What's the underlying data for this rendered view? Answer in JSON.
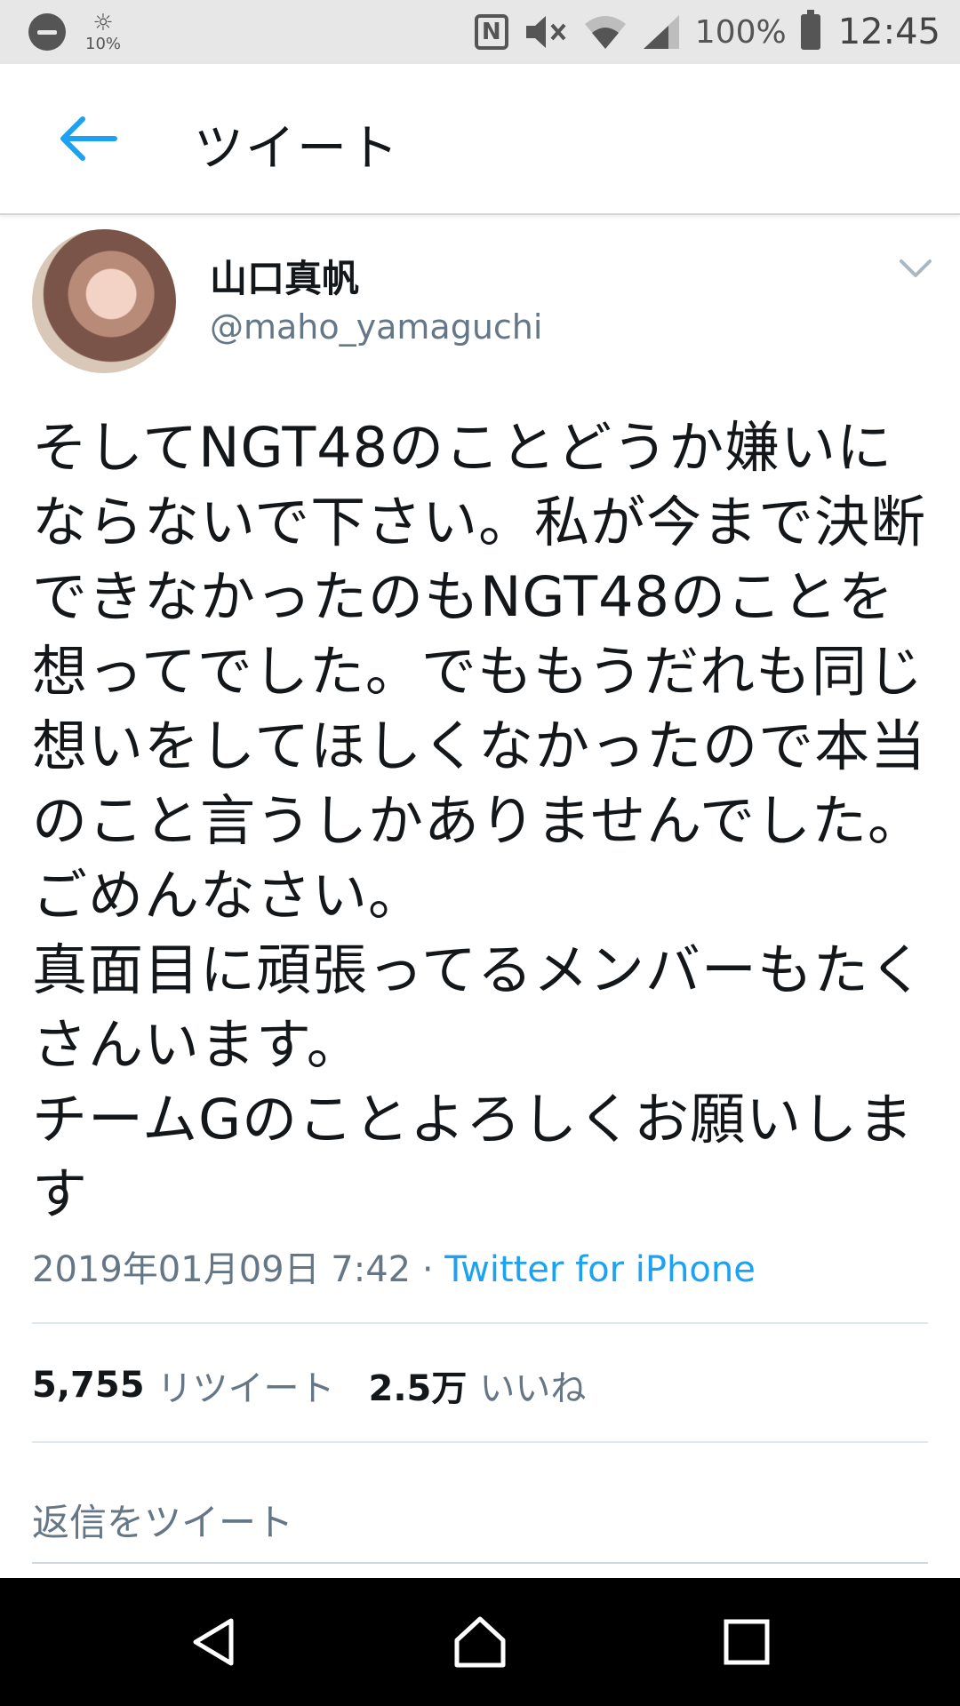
{
  "status_bar": {
    "brightness": "10%",
    "battery": "100%",
    "time": "12:45"
  },
  "header": {
    "title": "ツイート"
  },
  "tweet": {
    "author_name": "山口真帆",
    "author_handle": "@maho_yamaguchi",
    "text_paragraphs": [
      "そしてNGT48のことどうか嫌いにならないで下さい。私が今まで決断できなかったのもNGT48のことを想ってでした。でももうだれも同じ想いをしてほしくなかったので本当のこと言うしかありませんでした。ごめんなさい。",
      "真面目に頑張ってるメンバーもたくさんいます。",
      "チームGのことよろしくお願いします"
    ],
    "timestamp": "2019年01月09日 7:42",
    "separator": " · ",
    "source": "Twitter for iPhone",
    "retweet_count": "5,755",
    "retweet_label": "リツイート",
    "like_count": "2.5万",
    "like_label": "いいね"
  },
  "reply": {
    "placeholder": "返信をツイート"
  },
  "colors": {
    "accent": "#1da1f2",
    "secondary_text": "#657786",
    "primary_text": "#14171a"
  },
  "icons": [
    "do-not-disturb-icon",
    "brightness-icon",
    "nfc-icon",
    "mute-icon",
    "wifi-icon",
    "signal-icon",
    "battery-icon",
    "back-arrow-icon",
    "chevron-down-icon",
    "nav-back-icon",
    "nav-home-icon",
    "nav-recents-icon"
  ]
}
